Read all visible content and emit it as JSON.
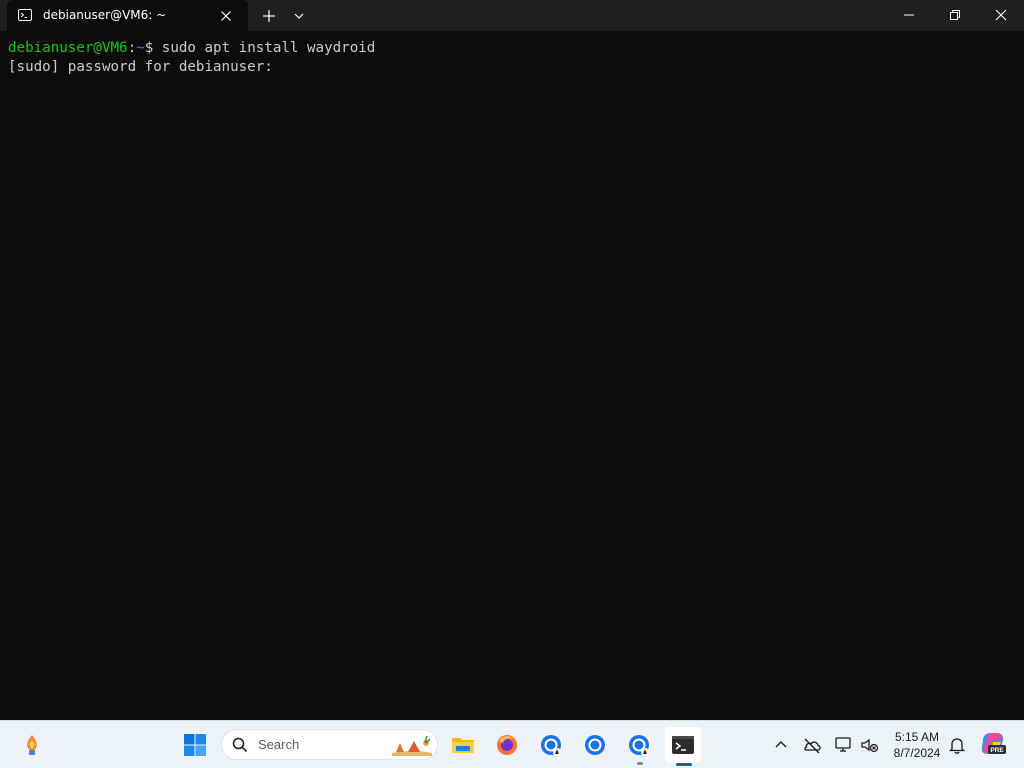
{
  "window": {
    "tab_title": "debianuser@VM6: ~",
    "tab_icon": "terminal-icon"
  },
  "terminal": {
    "prompt_user_host": "debianuser@VM6",
    "prompt_sep": ":",
    "prompt_path": "~",
    "prompt_symbol": "$",
    "command": " sudo apt install waydroid",
    "output_line": "[sudo] password for debianuser:"
  },
  "taskbar": {
    "search_placeholder": "Search",
    "clock_time": "5:15 AM",
    "clock_date": "8/7/2024",
    "pinned_apps": [
      "widgets",
      "start",
      "file-explorer",
      "firefox",
      "chrome",
      "chrome",
      "chrome",
      "terminal"
    ],
    "copilot_badge": "PRE"
  },
  "colors": {
    "terminal_bg": "#0c0c0c",
    "prompt_green": "#16c60c",
    "prompt_blue": "#3b78ff",
    "text": "#cccccc",
    "taskbar_bg": "#eef1f6",
    "accent": "#0067c0"
  }
}
